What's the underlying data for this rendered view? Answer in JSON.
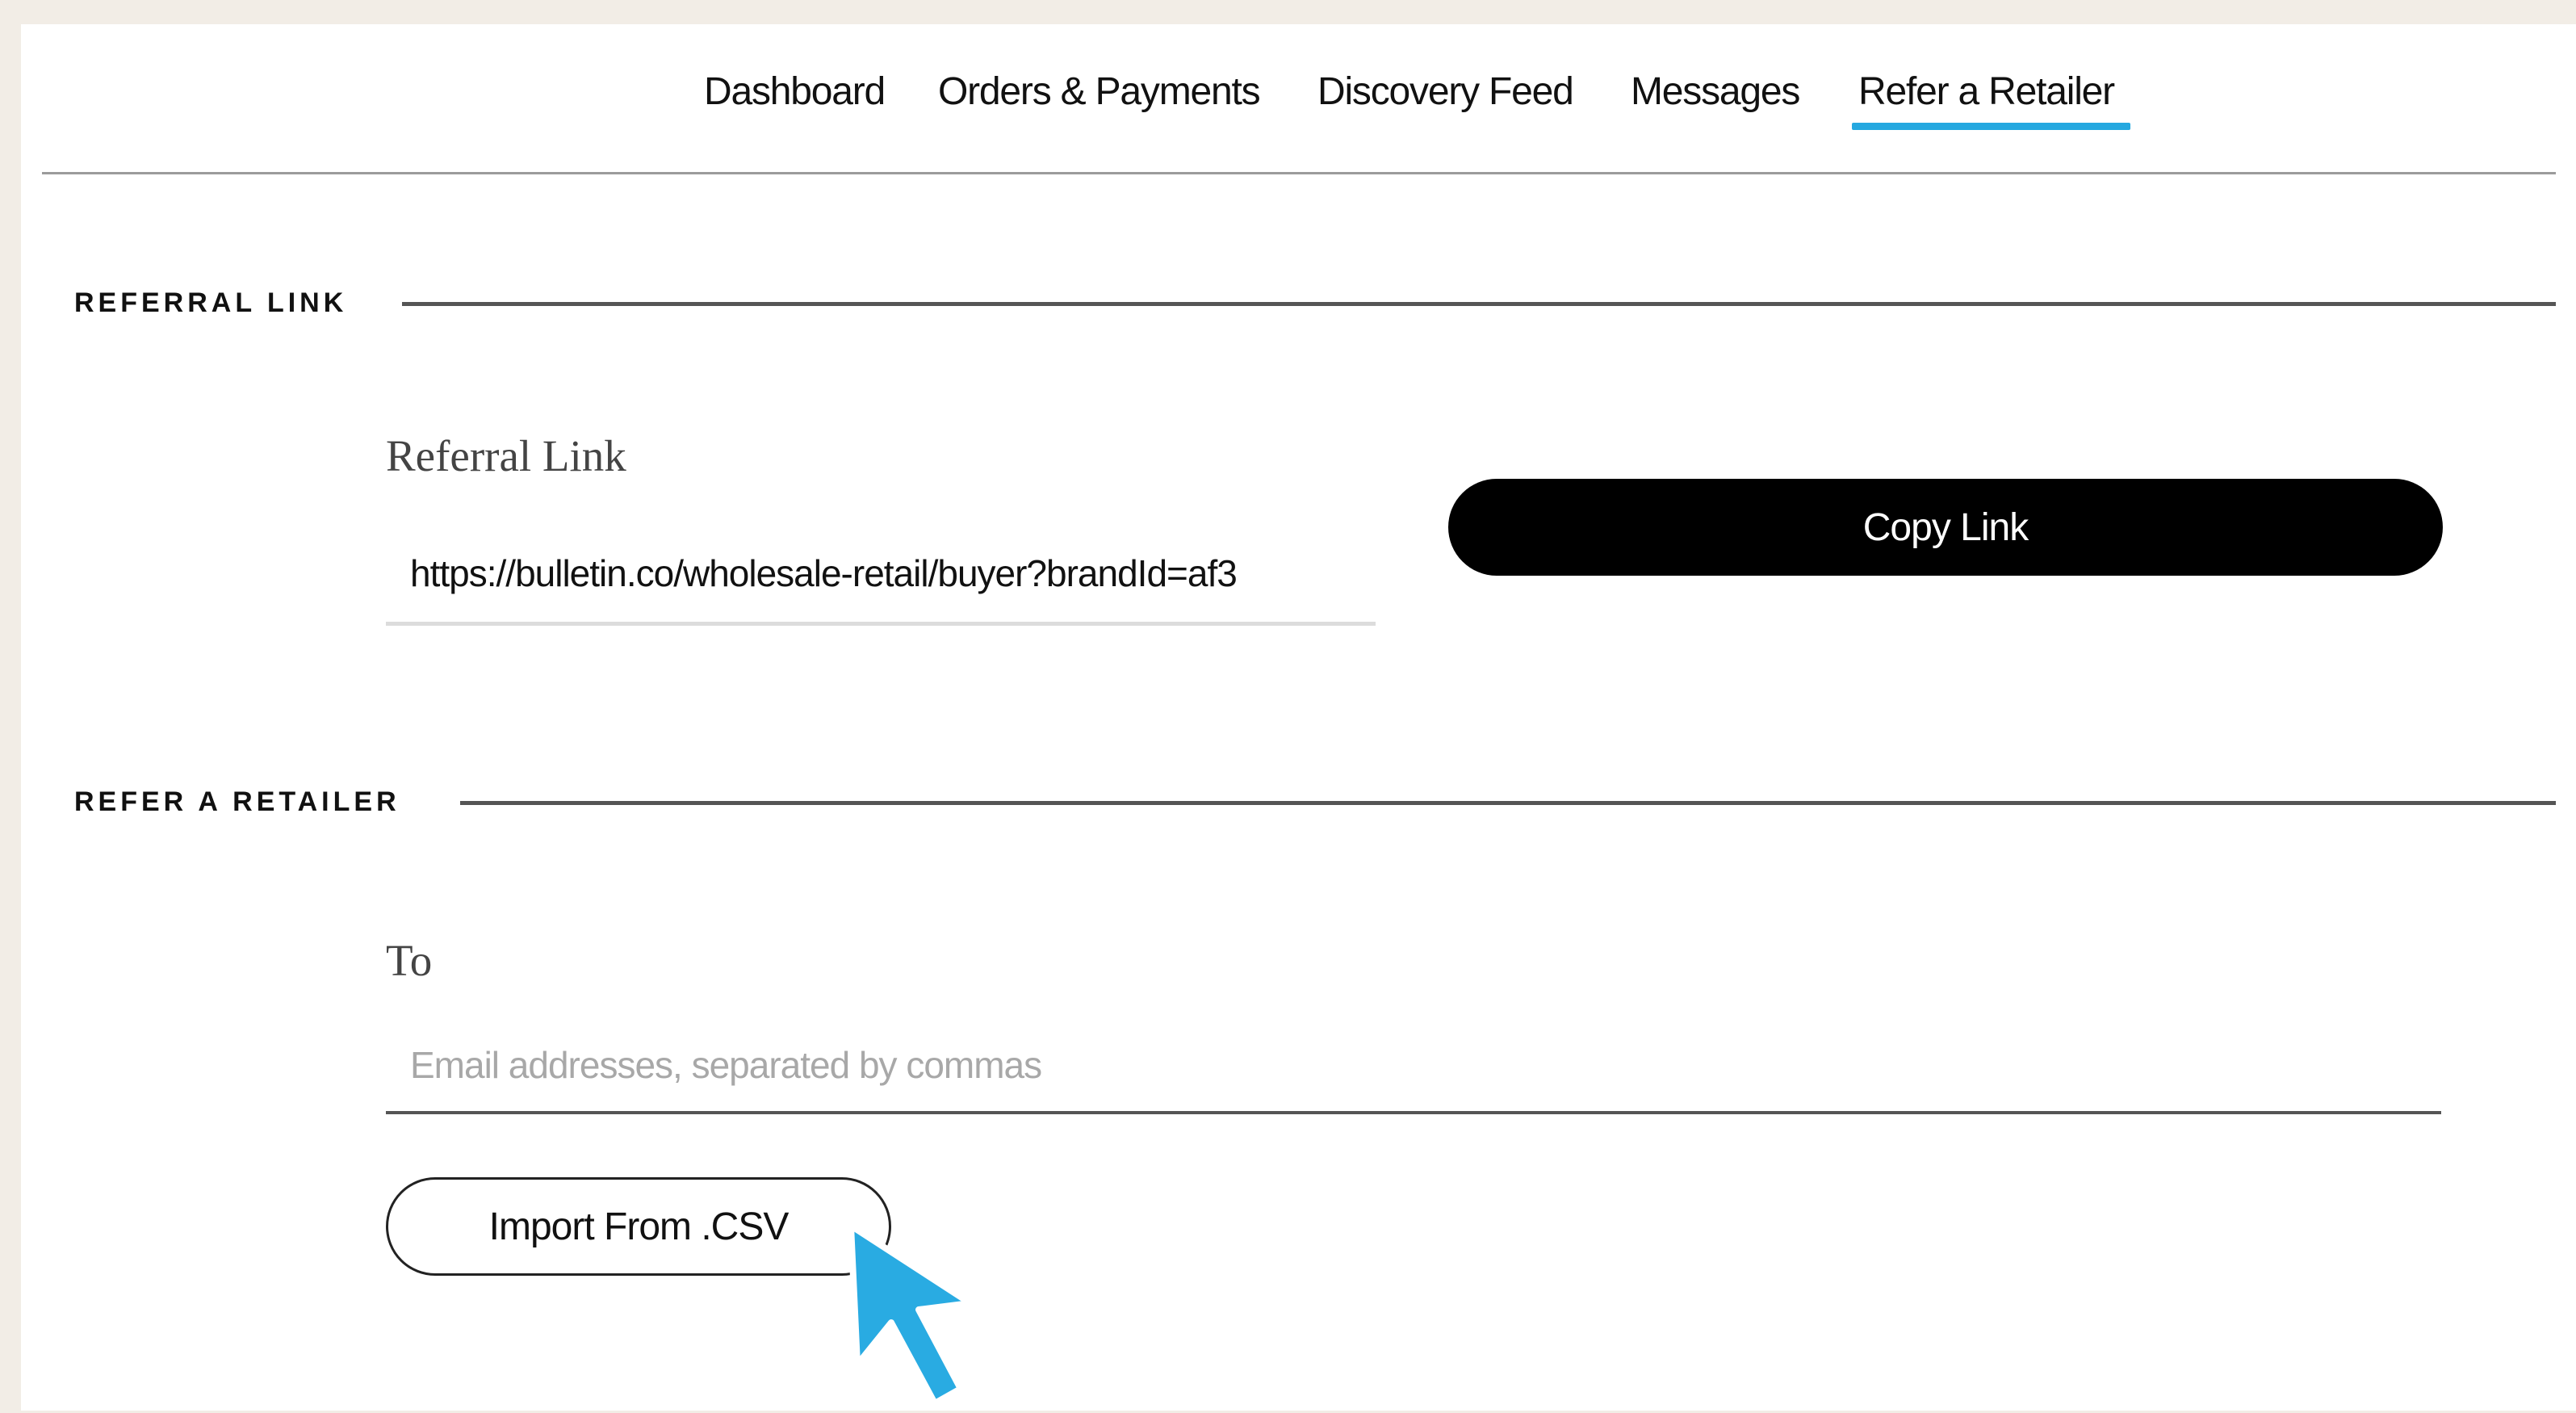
{
  "nav": {
    "items": [
      {
        "label": "Dashboard"
      },
      {
        "label": "Orders & Payments"
      },
      {
        "label": "Discovery Feed"
      },
      {
        "label": "Messages"
      },
      {
        "label": "Refer a Retailer"
      }
    ],
    "active_index": 4
  },
  "referral_section": {
    "title": "REFERRAL LINK",
    "field_label": "Referral Link",
    "link_value": "https://bulletin.co/wholesale-retail/buyer?brandId=af3",
    "copy_button": "Copy Link"
  },
  "refer_section": {
    "title": "REFER A RETAILER",
    "to_label": "To",
    "to_placeholder": "Email addresses, separated by commas",
    "import_button": "Import From .CSV"
  },
  "colors": {
    "accent": "#25a8e0",
    "background": "#f2ede6",
    "primary_button": "#000000",
    "cursor": "#29abe2"
  },
  "icons": {
    "cursor": "pointer-cursor-icon"
  }
}
